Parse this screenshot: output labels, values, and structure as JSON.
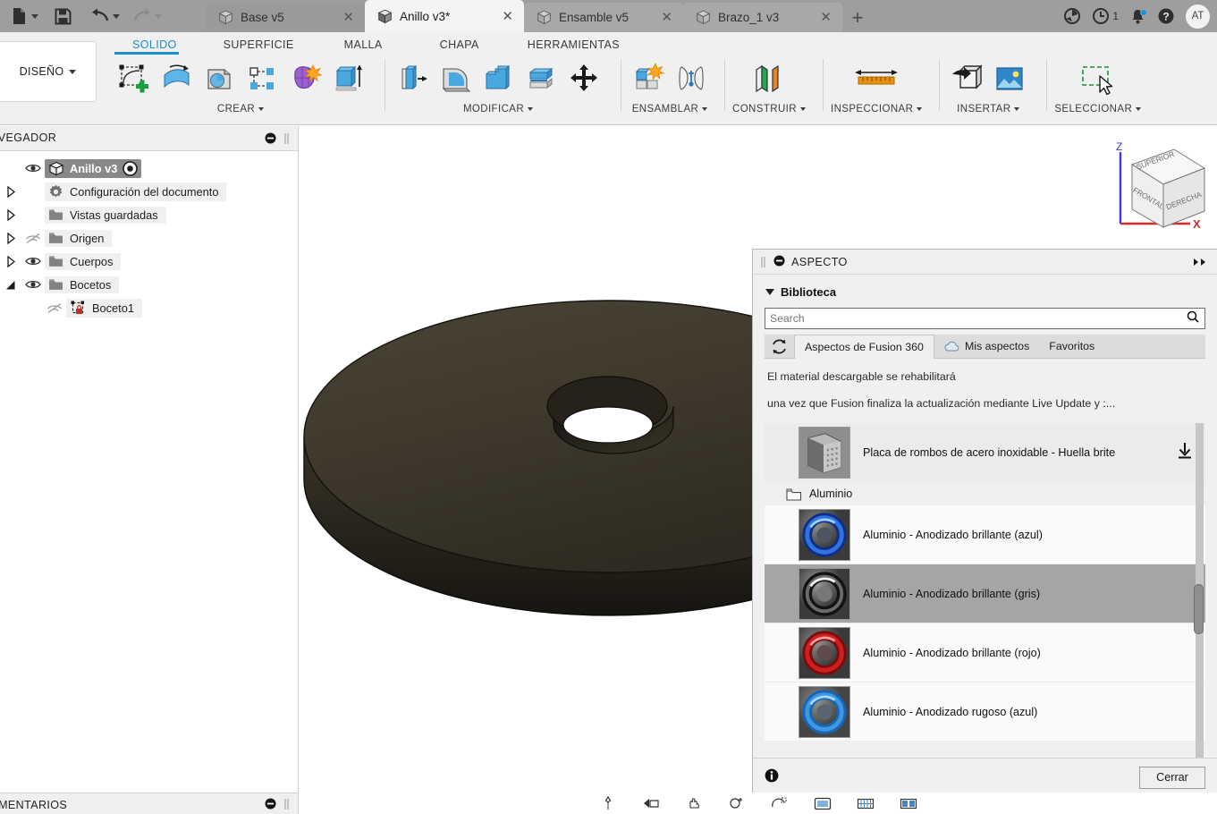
{
  "window": {
    "quick_access": [
      {
        "name": "new-file-button",
        "icon": "file-icon",
        "has_caret": true
      },
      {
        "name": "save-button",
        "icon": "save-icon",
        "has_caret": false
      },
      {
        "name": "undo-button",
        "icon": "undo-arrow-icon",
        "has_caret": true
      },
      {
        "name": "redo-button",
        "icon": "redo-arrow-icon",
        "has_caret": true
      }
    ],
    "tabs": [
      {
        "label": "Base v5",
        "active": false
      },
      {
        "label": "Anillo v3*",
        "active": true
      },
      {
        "label": "Ensamble v5",
        "active": false
      },
      {
        "label": "Brazo_1 v3",
        "active": false
      }
    ],
    "new_tab_label": "+",
    "close_glyph": "✕",
    "sys": {
      "job_status_icon": "job-status-icon",
      "history_icon": "clock-icon",
      "history_count": "1",
      "notifications_icon": "bell-icon",
      "help_icon": "help-icon",
      "avatar_initials": "AT"
    }
  },
  "ribbon": {
    "workspace": "DISEÑO",
    "tabs": [
      {
        "label": "SOLIDO",
        "selected": true
      },
      {
        "label": "SUPERFICIE",
        "selected": false
      },
      {
        "label": "MALLA",
        "selected": false
      },
      {
        "label": "CHAPA",
        "selected": false
      },
      {
        "label": "HERRAMIENTAS",
        "selected": false
      }
    ],
    "panels": [
      {
        "label": "CREAR",
        "has_caret": true,
        "items": [
          {
            "name": "create-sketch-icon"
          },
          {
            "name": "create-form-icon"
          },
          {
            "name": "create-cylinder-icon"
          },
          {
            "name": "create-pattern-icon"
          },
          {
            "name": "create-sculpt-icon"
          },
          {
            "name": "create-extrude-icon"
          }
        ]
      },
      {
        "label": "MODIFICAR",
        "has_caret": true,
        "items": [
          {
            "name": "press-pull-icon"
          },
          {
            "name": "fillet-icon"
          },
          {
            "name": "shell-icon"
          },
          {
            "name": "split-face-icon"
          },
          {
            "name": "move-copy-icon"
          }
        ]
      },
      {
        "label": "ENSAMBLAR",
        "has_caret": true,
        "items": [
          {
            "name": "new-component-icon"
          },
          {
            "name": "joint-icon"
          }
        ]
      },
      {
        "label": "CONSTRUIR",
        "has_caret": true,
        "items": [
          {
            "name": "offset-plane-icon"
          }
        ]
      },
      {
        "label": "INSPECCIONAR",
        "has_caret": true,
        "items": [
          {
            "name": "measure-icon"
          }
        ]
      },
      {
        "label": "INSERTAR",
        "has_caret": true,
        "items": [
          {
            "name": "insert-derive-icon"
          },
          {
            "name": "insert-canvas-icon"
          }
        ]
      },
      {
        "label": "SELECCIONAR",
        "has_caret": true,
        "items": [
          {
            "name": "selection-window-icon"
          }
        ]
      }
    ]
  },
  "browser": {
    "title": "AVEGADOR",
    "collapse_icon": "minus-circle-icon",
    "grip_icon": "grip-icon",
    "tree": [
      {
        "label": "Anillo v3",
        "type": "root",
        "eye": "visible",
        "has_twist": false,
        "icon": "component-cube-icon",
        "extra_icon": "activate-target-icon"
      },
      {
        "label": "Configuración del documento",
        "type": "node",
        "eye": "none",
        "has_twist": true,
        "twist": "collapsed",
        "icon": "gear-icon"
      },
      {
        "label": "Vistas guardadas",
        "type": "node",
        "eye": "none",
        "has_twist": true,
        "twist": "collapsed",
        "icon": "folder-icon"
      },
      {
        "label": "Origen",
        "type": "node",
        "eye": "hidden",
        "has_twist": true,
        "twist": "collapsed",
        "icon": "folder-icon"
      },
      {
        "label": "Cuerpos",
        "type": "node",
        "eye": "visible",
        "has_twist": true,
        "twist": "collapsed",
        "icon": "folder-icon"
      },
      {
        "label": "Bocetos",
        "type": "node",
        "eye": "visible",
        "has_twist": true,
        "twist": "expanded",
        "icon": "folder-icon"
      },
      {
        "label": "Boceto1",
        "type": "leaf",
        "eye": "hidden",
        "has_twist": false,
        "icon": "sketch-locked-icon"
      }
    ]
  },
  "viewport": {
    "model_name": "anillo-washer-model",
    "model_color": "#3d382c",
    "viewcube": {
      "faces": {
        "top": "SUPERIOR",
        "front": "FRONTAL",
        "right": "DERECHA"
      },
      "axes": {
        "z": "Z",
        "x": "X"
      },
      "z_color": "#3b3bd4",
      "x_color": "#d92a2a"
    }
  },
  "aspecto": {
    "title": "ASPECTO",
    "grip_icon": "grip-icon",
    "collapse_icon": "minus-circle-icon",
    "expand_icon": "double-chevron-right-icon",
    "library_section": "Biblioteca",
    "search": {
      "value": "",
      "placeholder": "Search",
      "icon": "search-icon"
    },
    "refresh_icon": "refresh-icon",
    "source_tabs": [
      {
        "label": "Aspectos de Fusion 360",
        "selected": true,
        "icon": ""
      },
      {
        "label": "Mis aspectos",
        "selected": false,
        "icon": "cloud-icon"
      },
      {
        "label": "Favoritos",
        "selected": false,
        "icon": ""
      }
    ],
    "notice_line1": "El material descargable se rehabilitará",
    "notice_line2": "una vez que Fusion finaliza la actualización mediante Live Update y :...",
    "list": [
      {
        "kind": "material",
        "label": "Placa de rombos de acero inoxidable - Huella brite",
        "selected": false,
        "downloadable": true,
        "swatch": "steel",
        "download_icon": "download-icon"
      },
      {
        "kind": "folder",
        "label": "Aluminio",
        "icon": "folder-icon"
      },
      {
        "kind": "material",
        "label": "Aluminio - Anodizado brillante (azul)",
        "selected": false,
        "downloadable": false,
        "swatch": "#1b4fbe"
      },
      {
        "kind": "material",
        "label": "Aluminio - Anodizado brillante (gris)",
        "selected": true,
        "downloadable": false,
        "swatch": "#2b2b2b"
      },
      {
        "kind": "material",
        "label": "Aluminio - Anodizado brillante (rojo)",
        "selected": false,
        "downloadable": false,
        "swatch": "#b01616"
      },
      {
        "kind": "material",
        "label": "Aluminio - Anodizado rugoso (azul)",
        "selected": false,
        "downloadable": false,
        "swatch": "#1f7ed0"
      }
    ],
    "info_icon": "info-icon",
    "close_button": "Cerrar"
  },
  "comments": {
    "title": "OMENTARIOS",
    "collapse_icon": "minus-circle-icon",
    "grip_icon": "grip-icon"
  },
  "navbar": [
    {
      "name": "orbit-free-icon"
    },
    {
      "name": "look-at-icon"
    },
    {
      "name": "pan-icon"
    },
    {
      "name": "zoom-icon"
    },
    {
      "name": "zoom-window-icon"
    },
    {
      "name": "display-settings-icon"
    },
    {
      "name": "grid-snap-icon"
    },
    {
      "name": "viewports-icon"
    }
  ],
  "colors": {
    "accent": "#1a8fd1",
    "titlebar": "#9e9e9e",
    "ribbon_bg": "#f0f0f0",
    "panel_bg": "#f0f0f0",
    "selection": "#a5a5a5"
  }
}
